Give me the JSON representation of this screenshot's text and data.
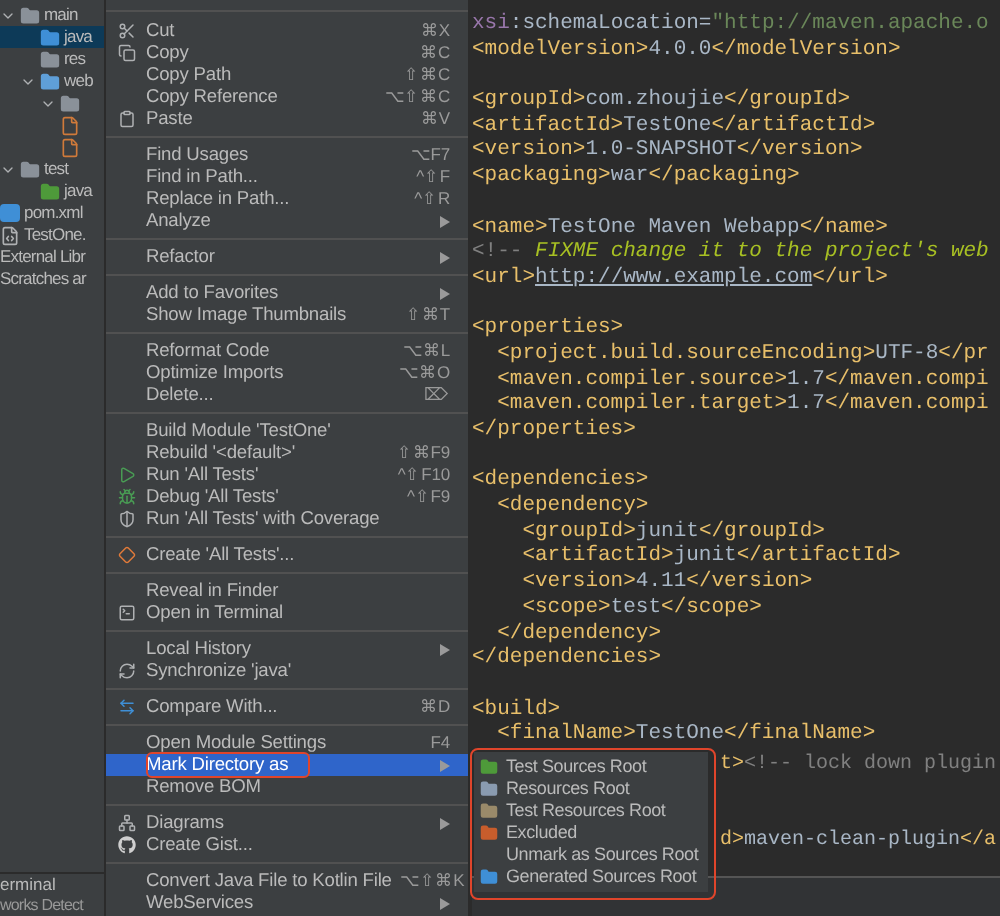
{
  "project_tree": {
    "items": [
      {
        "kind": "folder",
        "label": "main",
        "color": "#8a9199",
        "expanded": true,
        "selected": false,
        "children": [
          {
            "kind": "folder",
            "label": "java",
            "color": "#3f8fd6",
            "selected": true
          },
          {
            "kind": "folder",
            "label": "res",
            "color": "#8a9199",
            "selected": false
          },
          {
            "kind": "folder",
            "label": "web",
            "color": "#5f9fd8",
            "expanded": true,
            "selected": false,
            "children": [
              {
                "kind": "folder",
                "color": "#8a9199",
                "expanded": true,
                "selected": false,
                "children": [
                  {
                    "kind": "file",
                    "selected": false
                  },
                  {
                    "kind": "file",
                    "selected": false
                  }
                ]
              }
            ]
          }
        ]
      },
      {
        "kind": "folder",
        "label": "test",
        "color": "#8a9199",
        "expanded": true,
        "selected": false,
        "children": [
          {
            "kind": "folder",
            "label": "java",
            "color": "#4e9a3a",
            "selected": false
          }
        ]
      },
      {
        "kind": "maven",
        "label": "pom.xml",
        "selected": false
      },
      {
        "kind": "module",
        "label": "TestOne.",
        "selected": false
      },
      {
        "kind": "library",
        "label": "External Libr",
        "selected": false
      },
      {
        "kind": "scratch",
        "label": "Scratches ar",
        "selected": false
      }
    ],
    "bottom_bar": {
      "tool": "erminal",
      "status": "works Detect"
    }
  },
  "context_menu": {
    "items": [
      {
        "kind": "item",
        "label": "Cut",
        "shortcut": "⌘X",
        "submenu": false,
        "selected": false
      },
      {
        "kind": "item",
        "label": "Copy",
        "shortcut": "⌘C",
        "submenu": false,
        "selected": false
      },
      {
        "kind": "item",
        "label": "Copy Path",
        "shortcut": "⇧⌘C",
        "submenu": false,
        "selected": false
      },
      {
        "kind": "item",
        "label": "Copy Reference",
        "shortcut": "⌥⇧⌘C",
        "submenu": false,
        "selected": false
      },
      {
        "kind": "item",
        "label": "Paste",
        "shortcut": "⌘V",
        "submenu": false,
        "selected": false
      },
      {
        "kind": "separator"
      },
      {
        "kind": "item",
        "label": "Find Usages",
        "shortcut": "⌥F7",
        "submenu": false,
        "selected": false
      },
      {
        "kind": "item",
        "label": "Find in Path...",
        "shortcut": "^⇧F",
        "submenu": false,
        "selected": false
      },
      {
        "kind": "item",
        "label": "Replace in Path...",
        "shortcut": "^⇧R",
        "submenu": false,
        "selected": false
      },
      {
        "kind": "item",
        "label": "Analyze",
        "submenu": true,
        "selected": false
      },
      {
        "kind": "separator"
      },
      {
        "kind": "item",
        "label": "Refactor",
        "submenu": true,
        "selected": false
      },
      {
        "kind": "separator"
      },
      {
        "kind": "item",
        "label": "Add to Favorites",
        "submenu": true,
        "selected": false
      },
      {
        "kind": "item",
        "label": "Show Image Thumbnails",
        "shortcut": "⇧⌘T",
        "submenu": false,
        "selected": false
      },
      {
        "kind": "separator"
      },
      {
        "kind": "item",
        "label": "Reformat Code",
        "shortcut": "⌥⌘L",
        "submenu": false,
        "selected": false
      },
      {
        "kind": "item",
        "label": "Optimize Imports",
        "shortcut": "⌥⌘O",
        "submenu": false,
        "selected": false
      },
      {
        "kind": "item",
        "label": "Delete...",
        "shortcut": "⌦",
        "submenu": false,
        "selected": false
      },
      {
        "kind": "separator"
      },
      {
        "kind": "item",
        "label": "Build Module 'TestOne'",
        "submenu": false,
        "selected": false
      },
      {
        "kind": "item",
        "label": "Rebuild '<default>'",
        "shortcut": "⇧⌘F9",
        "submenu": false,
        "selected": false
      },
      {
        "kind": "item",
        "label": "Run 'All Tests'",
        "shortcut": "^⇧F10",
        "submenu": false,
        "selected": false
      },
      {
        "kind": "item",
        "label": "Debug 'All Tests'",
        "shortcut": "^⇧F9",
        "submenu": false,
        "selected": false
      },
      {
        "kind": "item",
        "label": "Run 'All Tests' with Coverage",
        "submenu": false,
        "selected": false
      },
      {
        "kind": "separator"
      },
      {
        "kind": "item",
        "label": "Create 'All Tests'...",
        "submenu": false,
        "selected": false
      },
      {
        "kind": "separator"
      },
      {
        "kind": "item",
        "label": "Reveal in Finder",
        "submenu": false,
        "selected": false
      },
      {
        "kind": "item",
        "label": "Open in Terminal",
        "submenu": false,
        "selected": false
      },
      {
        "kind": "separator"
      },
      {
        "kind": "item",
        "label": "Local History",
        "submenu": true,
        "selected": false
      },
      {
        "kind": "item",
        "label": "Synchronize 'java'",
        "submenu": false,
        "selected": false
      },
      {
        "kind": "separator"
      },
      {
        "kind": "item",
        "label": "Compare With...",
        "shortcut": "⌘D",
        "submenu": false,
        "selected": false
      },
      {
        "kind": "separator"
      },
      {
        "kind": "item",
        "label": "Open Module Settings",
        "shortcut": "F4",
        "submenu": false,
        "selected": false
      },
      {
        "kind": "item",
        "label": "Mark Directory as",
        "submenu": true,
        "selected": true
      },
      {
        "kind": "item",
        "label": "Remove BOM",
        "submenu": false,
        "selected": false
      },
      {
        "kind": "separator"
      },
      {
        "kind": "item",
        "label": "Diagrams",
        "submenu": true,
        "selected": false
      },
      {
        "kind": "item",
        "label": "Create Gist...",
        "submenu": false,
        "selected": false
      },
      {
        "kind": "separator"
      },
      {
        "kind": "item",
        "label": "Convert Java File to Kotlin File",
        "shortcut": "⌥⇧⌘K",
        "submenu": false,
        "selected": false
      },
      {
        "kind": "item",
        "label": "WebServices",
        "submenu": true,
        "selected": false
      }
    ]
  },
  "submenu": {
    "items": [
      {
        "label": "Test Sources Root",
        "color": "#4e9a3a"
      },
      {
        "label": "Resources Root",
        "color": "#8a9bb0"
      },
      {
        "label": "Test Resources Root",
        "color": "#9a8a6a"
      },
      {
        "label": "Excluded",
        "color": "#c75d2c"
      },
      {
        "label": "Unmark as Sources Root"
      },
      {
        "label": "Generated Sources Root",
        "color": "#3f8fd6"
      }
    ]
  },
  "editor": {
    "blocks": [
      [
        [
          {
            "kind": "attr",
            "text": "xsi"
          },
          {
            "kind": "text",
            "text": ":schemaLocation="
          },
          {
            "kind": "value",
            "text": "\"http://maven.apache.o"
          }
        ],
        [
          {
            "kind": "tag",
            "text": "<modelVersion>"
          },
          {
            "kind": "text",
            "text": "4.0.0"
          },
          {
            "kind": "tag",
            "text": "</modelVersion>"
          }
        ]
      ],
      [
        [
          {
            "kind": "tag",
            "text": "<groupId>"
          },
          {
            "kind": "text",
            "text": "com.zhoujie"
          },
          {
            "kind": "tag",
            "text": "</groupId>"
          }
        ],
        [
          {
            "kind": "tag",
            "text": "<artifactId>"
          },
          {
            "kind": "text",
            "text": "TestOne"
          },
          {
            "kind": "tag",
            "text": "</artifactId>"
          }
        ],
        [
          {
            "kind": "tag",
            "text": "<version>"
          },
          {
            "kind": "text",
            "text": "1.0-SNAPSHOT"
          },
          {
            "kind": "tag",
            "text": "</version>"
          }
        ],
        [
          {
            "kind": "tag",
            "text": "<packaging>"
          },
          {
            "kind": "text",
            "text": "war"
          },
          {
            "kind": "tag",
            "text": "</packaging>"
          }
        ]
      ],
      [
        [
          {
            "kind": "tag",
            "text": "<name>"
          },
          {
            "kind": "text",
            "text": "TestOne Maven Webapp"
          },
          {
            "kind": "tag",
            "text": "</name>"
          }
        ],
        [
          {
            "kind": "comment",
            "text": "<!-- "
          },
          {
            "kind": "todo",
            "text": "FIXME change it to the project's web"
          }
        ],
        [
          {
            "kind": "tag",
            "text": "<url>"
          },
          {
            "kind": "link",
            "text": "http://www.example.com"
          },
          {
            "kind": "tag",
            "text": "</url>"
          }
        ]
      ],
      [
        [
          {
            "kind": "tag",
            "text": "<properties>"
          }
        ],
        [
          {
            "kind": "tag",
            "text": "  <project.build.sourceEncoding>"
          },
          {
            "kind": "text",
            "text": "UTF-8"
          },
          {
            "kind": "tag",
            "text": "</pr"
          }
        ],
        [
          {
            "kind": "tag",
            "text": "  <maven.compiler.source>"
          },
          {
            "kind": "text",
            "text": "1.7"
          },
          {
            "kind": "tag",
            "text": "</maven.compi"
          }
        ],
        [
          {
            "kind": "tag",
            "text": "  <maven.compiler.target>"
          },
          {
            "kind": "text",
            "text": "1.7"
          },
          {
            "kind": "tag",
            "text": "</maven.compi"
          }
        ],
        [
          {
            "kind": "tag",
            "text": "</properties>"
          }
        ]
      ],
      [
        [
          {
            "kind": "tag",
            "text": "<dependencies>"
          }
        ],
        [
          {
            "kind": "tag",
            "text": "  <dependency>"
          }
        ],
        [
          {
            "kind": "tag",
            "text": "    <groupId>"
          },
          {
            "kind": "text",
            "text": "junit"
          },
          {
            "kind": "tag",
            "text": "</groupId>"
          }
        ],
        [
          {
            "kind": "tag",
            "text": "    <artifactId>"
          },
          {
            "kind": "text",
            "text": "junit"
          },
          {
            "kind": "tag",
            "text": "</artifactId>"
          }
        ],
        [
          {
            "kind": "tag",
            "text": "    <version>"
          },
          {
            "kind": "text",
            "text": "4.11"
          },
          {
            "kind": "tag",
            "text": "</version>"
          }
        ],
        [
          {
            "kind": "tag",
            "text": "    <scope>"
          },
          {
            "kind": "text",
            "text": "test"
          },
          {
            "kind": "tag",
            "text": "</scope>"
          }
        ],
        [
          {
            "kind": "tag",
            "text": "  </dependency>"
          }
        ],
        [
          {
            "kind": "tag",
            "text": "</dependencies>"
          }
        ]
      ],
      [
        [
          {
            "kind": "tag",
            "text": "<build>"
          }
        ],
        [
          {
            "kind": "tag",
            "text": "  <finalName>"
          },
          {
            "kind": "text",
            "text": "TestOne"
          },
          {
            "kind": "tag",
            "text": "</finalName>"
          }
        ]
      ]
    ],
    "lines_beside_submenu": [
      [
        {
          "kind": "tag",
          "text": "t>"
        },
        {
          "kind": "comment",
          "text": "<!-- lock down plugin"
        }
      ],
      [
        {
          "kind": "tag",
          "text": "d>"
        },
        {
          "kind": "text",
          "text": "maven-clean-plugin"
        },
        {
          "kind": "tag",
          "text": "</a"
        }
      ]
    ]
  }
}
